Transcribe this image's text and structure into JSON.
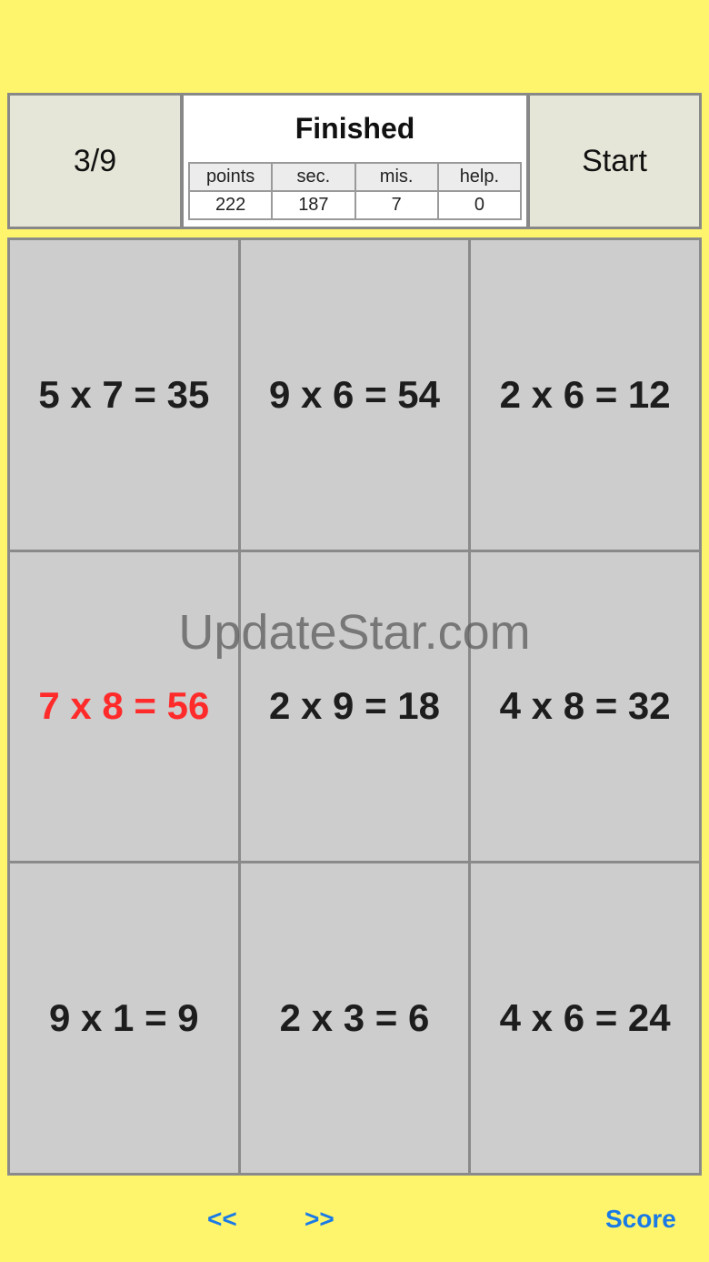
{
  "header": {
    "progress": "3/9",
    "status_title": "Finished",
    "start_label": "Start",
    "stats_headers": [
      "points",
      "sec.",
      "mis.",
      "help."
    ],
    "stats_values": [
      "222",
      "187",
      "7",
      "0"
    ]
  },
  "cards": [
    {
      "text": "5 x 7 = 35",
      "wrong": false
    },
    {
      "text": "9 x 6 = 54",
      "wrong": false
    },
    {
      "text": "2 x 6 = 12",
      "wrong": false
    },
    {
      "text": "7 x 8 = 56",
      "wrong": true
    },
    {
      "text": "2 x 9 = 18",
      "wrong": false
    },
    {
      "text": "4 x 8 = 32",
      "wrong": false
    },
    {
      "text": "9 x 1 = 9",
      "wrong": false
    },
    {
      "text": "2 x 3 = 6",
      "wrong": false
    },
    {
      "text": "4 x 6 = 24",
      "wrong": false
    }
  ],
  "watermark": "UpdateStar.com",
  "footer": {
    "prev_label": "<<",
    "next_label": ">>",
    "score_label": "Score"
  },
  "colors": {
    "background": "#fff56c",
    "card": "#cdcdcd",
    "wrong_text": "#ff2a2a",
    "link": "#1a7ae6"
  }
}
